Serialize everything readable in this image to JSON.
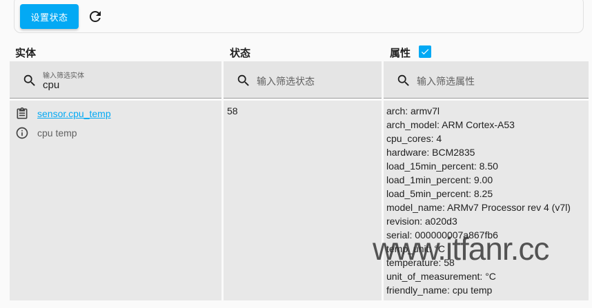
{
  "toolbar": {
    "set_state_label": "设置状态",
    "refresh_icon": "refresh-icon"
  },
  "columns": {
    "entity": "实体",
    "state": "状态",
    "attributes": "属性",
    "attributes_checked": true
  },
  "filters": {
    "entity": {
      "label": "输入筛选实体",
      "value": "cpu"
    },
    "state": {
      "placeholder": "输入筛选状态"
    },
    "attributes": {
      "placeholder": "输入筛选属性"
    }
  },
  "rows": [
    {
      "entity_id": "sensor.cpu_temp",
      "friendly_name": "cpu temp",
      "state": "58",
      "attributes": [
        "arch: armv7l",
        "arch_model: ARM Cortex-A53",
        "cpu_cores: 4",
        "hardware: BCM2835",
        "load_15min_percent: 8.50",
        "load_1min_percent: 9.00",
        "load_5min_percent: 8.25",
        "model_name: ARMv7 Processor rev 4 (v7l)",
        "revision: a020d3",
        "serial: 000000007a867fb6",
        "temp_unit: °C",
        "temperature: 58",
        "unit_of_measurement: °C",
        "friendly_name: cpu temp"
      ]
    }
  ],
  "watermark": "www.itfanr.cc",
  "colors": {
    "accent": "#03a9f4",
    "panel": "#e8e8e8",
    "filter_bg": "#e5e5e5"
  }
}
